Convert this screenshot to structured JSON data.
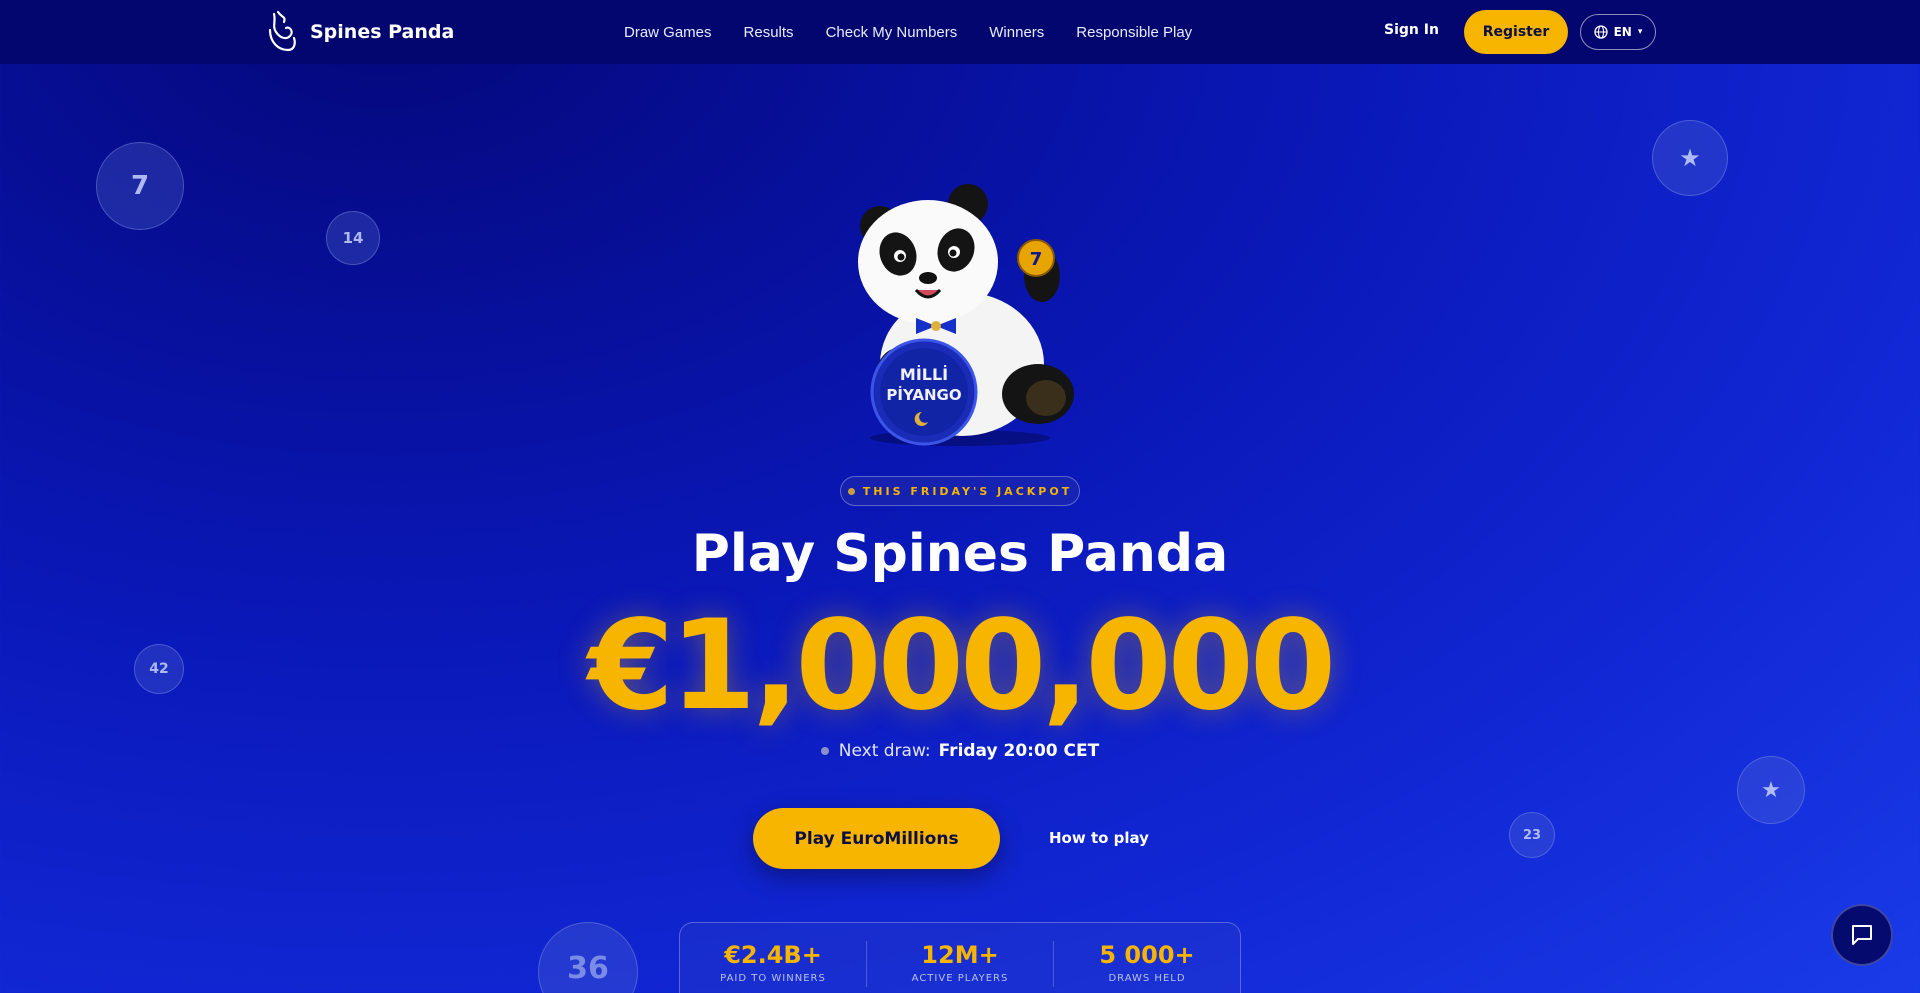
{
  "brand": {
    "name": "Spines Panda"
  },
  "nav": {
    "links": [
      "Draw Games",
      "Results",
      "Check My Numbers",
      "Winners",
      "Responsible Play"
    ],
    "sign_in": "Sign In",
    "register": "Register",
    "language": "EN"
  },
  "balls": [
    "7",
    "14",
    "42",
    "36",
    "23",
    "★",
    "★"
  ],
  "hero": {
    "badge": "THIS FRIDAY'S JACKPOT",
    "title": "Play Spines Panda",
    "jackpot": "€1,000,000",
    "next_draw_label": "Next draw:",
    "next_draw_value": "Friday 20:00 CET",
    "play_button": "Play EuroMillions",
    "how_to_play": "How to play",
    "mascot_ball_text": "MİLLİ PİYANGO",
    "mascot_number": "7"
  },
  "stats": [
    {
      "value": "€2.4B+",
      "label": "PAID TO WINNERS"
    },
    {
      "value": "12M+",
      "label": "ACTIVE PLAYERS"
    },
    {
      "value": "5 000+",
      "label": "DRAWS HELD"
    }
  ],
  "colors": {
    "accent": "#f7b500",
    "nav_bg": "#03066f",
    "bg": "#1228d6"
  }
}
